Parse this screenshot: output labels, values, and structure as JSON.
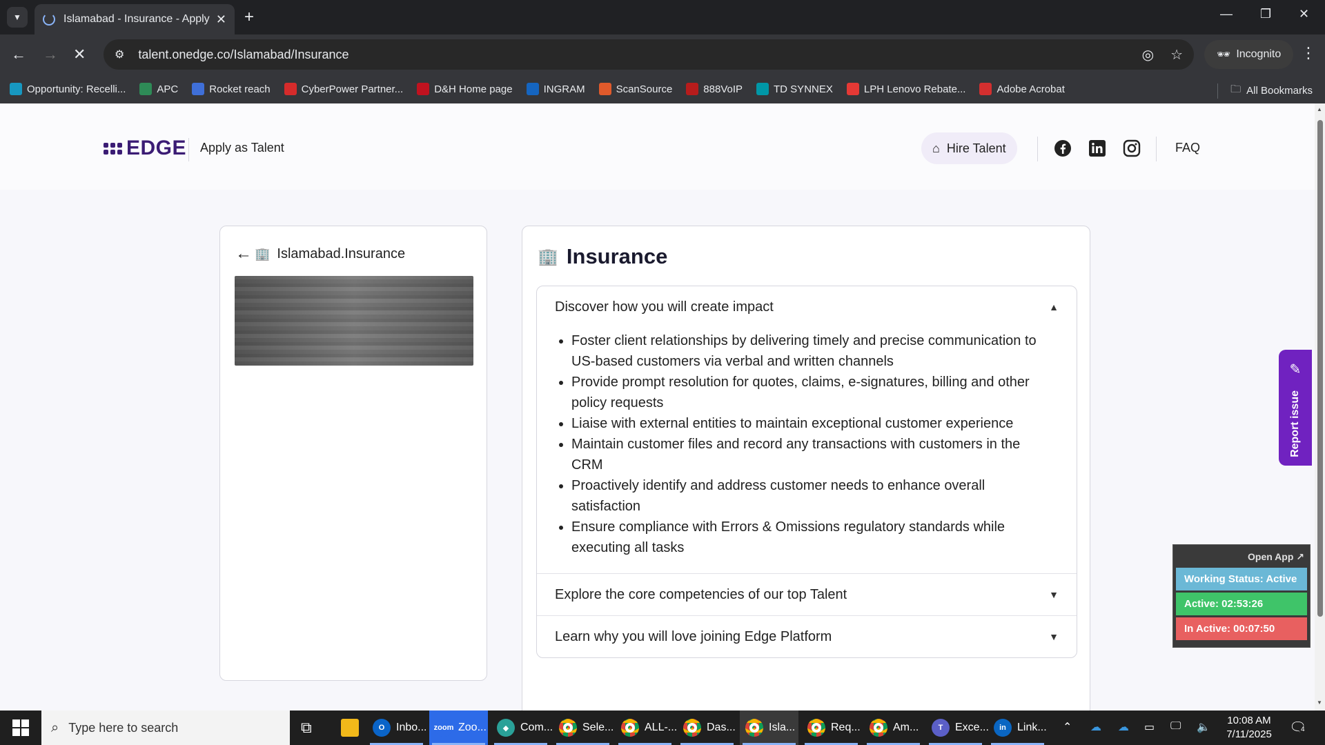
{
  "browser": {
    "tab_title": "Islamabad - Insurance - Apply f",
    "new_tab_symbol": "+",
    "url": "talent.onedge.co/Islamabad/Insurance",
    "incognito_label": "Incognito",
    "bookmarks": [
      {
        "label": "Opportunity: Recelli...",
        "icon_color": "#1798c1",
        "icon": "cloud-icon"
      },
      {
        "label": "APC",
        "icon_color": "#2e8b57",
        "icon": "apc-icon"
      },
      {
        "label": "Rocket reach",
        "icon_color": "#3f6fd8",
        "icon": "rocket-icon"
      },
      {
        "label": "CyberPower Partner...",
        "icon_color": "#d62b2b",
        "icon": "cp-icon"
      },
      {
        "label": "D&H Home page",
        "icon_color": "#c1121f",
        "icon": "dh-icon"
      },
      {
        "label": "INGRAM",
        "icon_color": "#1565c0",
        "icon": "ingram-icon"
      },
      {
        "label": "ScanSource",
        "icon_color": "#e05a2b",
        "icon": "scansource-icon"
      },
      {
        "label": "888VoIP",
        "icon_color": "#b71c1c",
        "icon": "voip-icon"
      },
      {
        "label": "TD SYNNEX",
        "icon_color": "#0097a7",
        "icon": "tdsynnex-icon"
      },
      {
        "label": "LPH Lenovo Rebate...",
        "icon_color": "#e53935",
        "icon": "lenovo-icon"
      },
      {
        "label": "Adobe Acrobat",
        "icon_color": "#d32f2f",
        "icon": "acrobat-icon"
      }
    ],
    "all_bookmarks_label": "All Bookmarks"
  },
  "header": {
    "logo_text": "EDGE",
    "apply_label": "Apply as Talent",
    "hire_label": "Hire Talent",
    "faq_label": "FAQ"
  },
  "left_card": {
    "title": "Islamabad.Insurance"
  },
  "right_card": {
    "title": "Insurance",
    "sections": [
      {
        "heading": "Discover how you will create impact",
        "expanded": true,
        "items": [
          "Foster client relationships by delivering timely and precise communication to US-based customers via verbal and written channels",
          "Provide prompt resolution for quotes, claims, e-signatures, billing and other policy requests",
          "Liaise with external entities to maintain exceptional customer experience",
          "Maintain customer files and record any transactions with customers in the CRM",
          "Proactively identify and address customer needs to enhance overall satisfaction",
          "Ensure compliance with Errors & Omissions regulatory standards while executing all tasks"
        ]
      },
      {
        "heading": "Explore the core competencies of our top Talent",
        "expanded": false
      },
      {
        "heading": "Learn why you will love joining Edge Platform",
        "expanded": false
      }
    ]
  },
  "report_issue": {
    "label": "Report issue"
  },
  "status_widget": {
    "open_app": "Open App ↗",
    "working_status": "Working Status: Active",
    "active": "Active: 02:53:26",
    "inactive": "In Active: 00:07:50"
  },
  "taskbar": {
    "search_placeholder": "Type here to search",
    "apps": [
      {
        "label": "Inbo...",
        "color": "#0a64c8",
        "icon": "outlook-icon",
        "glyph": "O"
      },
      {
        "label": "Zoo...",
        "color": "#2d6be8",
        "icon": "zoom-icon",
        "glyph": "zoom"
      },
      {
        "label": "Com...",
        "color": "#2aa198",
        "icon": "com-icon",
        "glyph": "◆"
      },
      {
        "label": "Sele...",
        "color": "#db4437",
        "icon": "chrome-icon",
        "glyph": ""
      },
      {
        "label": "ALL-...",
        "color": "#db4437",
        "icon": "chrome-icon",
        "glyph": ""
      },
      {
        "label": "Das...",
        "color": "#db4437",
        "icon": "chrome-icon",
        "glyph": ""
      },
      {
        "label": "Isla...",
        "color": "#db4437",
        "icon": "chrome-icon",
        "glyph": ""
      },
      {
        "label": "Req...",
        "color": "#db4437",
        "icon": "chrome-icon",
        "glyph": ""
      },
      {
        "label": "Am...",
        "color": "#db4437",
        "icon": "chrome-icon",
        "glyph": ""
      },
      {
        "label": "Exce...",
        "color": "#5b5fc7",
        "icon": "teams-icon",
        "glyph": "T"
      },
      {
        "label": "Link...",
        "color": "#0a66c2",
        "icon": "linkedin-icon",
        "glyph": "in"
      }
    ],
    "time": "10:08 AM",
    "date": "7/11/2025",
    "notification_count": "4"
  }
}
